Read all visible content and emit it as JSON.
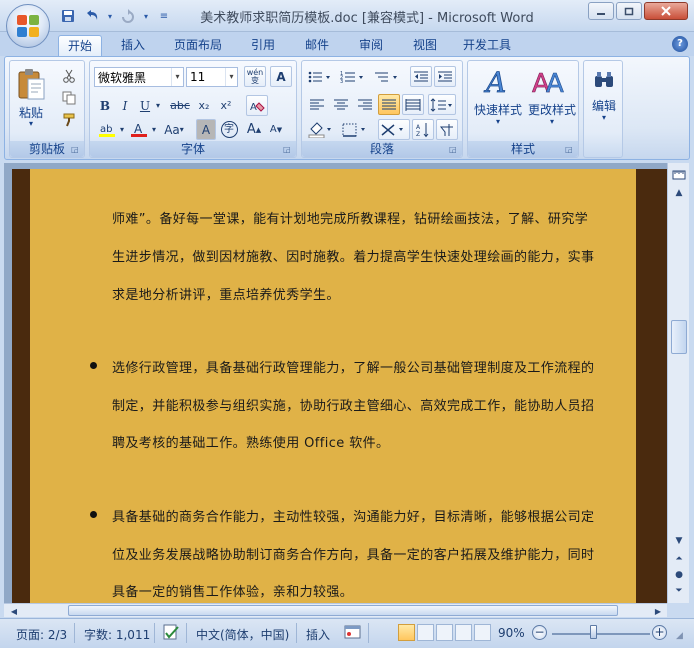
{
  "window": {
    "title": "美术教师求职简历模板.doc [兼容模式] - Microsoft Word",
    "controls": [
      "minimize",
      "restore",
      "close"
    ]
  },
  "ribbon": {
    "tabs": [
      "开始",
      "插入",
      "页面布局",
      "引用",
      "邮件",
      "审阅",
      "视图",
      "开发工具"
    ],
    "active_tab": "开始",
    "clipboard": {
      "paste_label": "粘贴",
      "group_label": "剪贴板"
    },
    "font": {
      "family": "微软雅黑",
      "size": "11",
      "wen_label": "wén\n变",
      "group_label": "字体",
      "grow_label": "A",
      "shrink_label": "A",
      "aa_label": "Aa",
      "char_border_label": "A",
      "enclose_label": "字"
    },
    "paragraph": {
      "group_label": "段落"
    },
    "styles": {
      "quick_label": "快速样式",
      "change_label": "更改样式",
      "group_label": "样式"
    },
    "editing": {
      "label": "编辑"
    }
  },
  "document": {
    "lines": [
      {
        "text": "师难”。备好每一堂课，能有计划地完成所教课程，钻研绘画技法，了解、研究学",
        "bullet": false
      },
      {
        "text": "生进步情况，做到因材施教、因时施教。着力提高学生快速处理绘画的能力，实事",
        "bullet": false
      },
      {
        "text": "求是地分析讲评，重点培养优秀学生。",
        "bullet": false
      },
      {
        "text": "选修行政管理，具备基础行政管理能力，了解一般公司基础管理制度及工作流程的",
        "bullet": true
      },
      {
        "text": "制定，并能积极参与组织实施，协助行政主管细心、高效完成工作，能协助人员招",
        "bullet": false
      },
      {
        "text": "聘及考核的基础工作。熟练使用 Office 软件。",
        "bullet": false
      },
      {
        "text": "具备基础的商务合作能力，主动性较强，沟通能力好，目标清晰，能够根据公司定",
        "bullet": true
      },
      {
        "text": "位及业务发展战略协助制订商务合作方向，具备一定的客户拓展及维护能力，同时",
        "bullet": false
      },
      {
        "text": "具备一定的销售工作体验，亲和力较强。",
        "bullet": false
      }
    ]
  },
  "statusbar": {
    "page": "页面: 2/3",
    "words": "字数: 1,011",
    "language": "中文(简体，中国)",
    "mode": "插入",
    "zoom": "90%"
  },
  "colors": {
    "page_background": "#e0b247",
    "page_border": "#4a2a0e",
    "text": "#1a1a1a",
    "ribbon_text": "#15428b"
  }
}
